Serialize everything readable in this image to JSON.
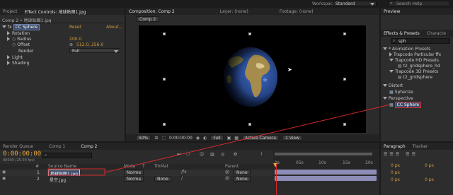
{
  "top_bar": {
    "workspace_label": "Workspace:",
    "workspace_value": "Standard",
    "search_placeholder": "Search Help"
  },
  "left_panel": {
    "tabs": [
      "Project",
      "Effect Controls: 地球贴图1.jpg"
    ],
    "layer_path": "Comp 2 • 地球贴图1.jpg",
    "effect": {
      "name": "CC Sphere",
      "reset": "Reset",
      "about": "About..."
    },
    "properties": [
      {
        "label": "Rotation",
        "value": ""
      },
      {
        "label": "Radius",
        "value": "200.0"
      },
      {
        "label": "Offset",
        "value": "512.0, 256.0"
      },
      {
        "label": "Render",
        "value": "Full"
      },
      {
        "label": "Light",
        "value": ""
      },
      {
        "label": "Shading",
        "value": ""
      }
    ]
  },
  "viewer": {
    "tabs": [
      "Composition: Comp 2",
      "Layer: (none)",
      "Footage: (none)"
    ],
    "comp_tab": "Comp 2",
    "bottom": {
      "zoom": "50%",
      "timecode": "0:00:00:00",
      "resolution": "Full",
      "view": "Active Camera",
      "views": "1 View"
    }
  },
  "right_panel": {
    "preview_title": "Preview",
    "effects_tabs": [
      "Effects & Presets",
      "Characte"
    ],
    "search_value": "sph",
    "tree": [
      {
        "label": "* Animation Presets",
        "depth": 0
      },
      {
        "label": "Trapcode Particular ffx",
        "depth": 1
      },
      {
        "label": "Trapcode HD Presets",
        "depth": 1
      },
      {
        "label": "t2_gridsphere_hd",
        "depth": 2
      },
      {
        "label": "Trapcode 3D Presets",
        "depth": 1
      },
      {
        "label": "t2_gridsphere",
        "depth": 2
      },
      {
        "label": "Distort",
        "depth": 0
      },
      {
        "label": "Spherize",
        "depth": 1
      },
      {
        "label": "Perspective",
        "depth": 0
      },
      {
        "label": "CC Sphere",
        "depth": 1
      }
    ],
    "paragraph_tabs": [
      "Paragraph",
      "Tracker"
    ],
    "paragraph_values": [
      "0 px",
      "0 px",
      "0 px",
      "0 px",
      "0 px"
    ]
  },
  "timeline": {
    "tabs": [
      "Render Queue",
      "Comp 1",
      "Comp 2"
    ],
    "timecode": "0:00:00:00",
    "fps": "00000 (25.00 fps)",
    "columns": [
      "#",
      "Source Name",
      "Mode",
      "T",
      "TrkMat",
      "Parent"
    ],
    "layers": [
      {
        "index": "1",
        "name": "地球贴图1.jpg",
        "mode": "Norma",
        "trkmat": "",
        "parent": "None"
      },
      {
        "index": "2",
        "name": "星空.jpg",
        "mode": "Norma",
        "trkmat": "None",
        "parent": "None"
      }
    ],
    "ruler": [
      "0s",
      "05s",
      "10s",
      "15s",
      "20s"
    ]
  },
  "colors": {
    "highlight_red": "#d42a2a",
    "label_orange": "#d59b3a",
    "track_lavender": "#8d8db8"
  }
}
